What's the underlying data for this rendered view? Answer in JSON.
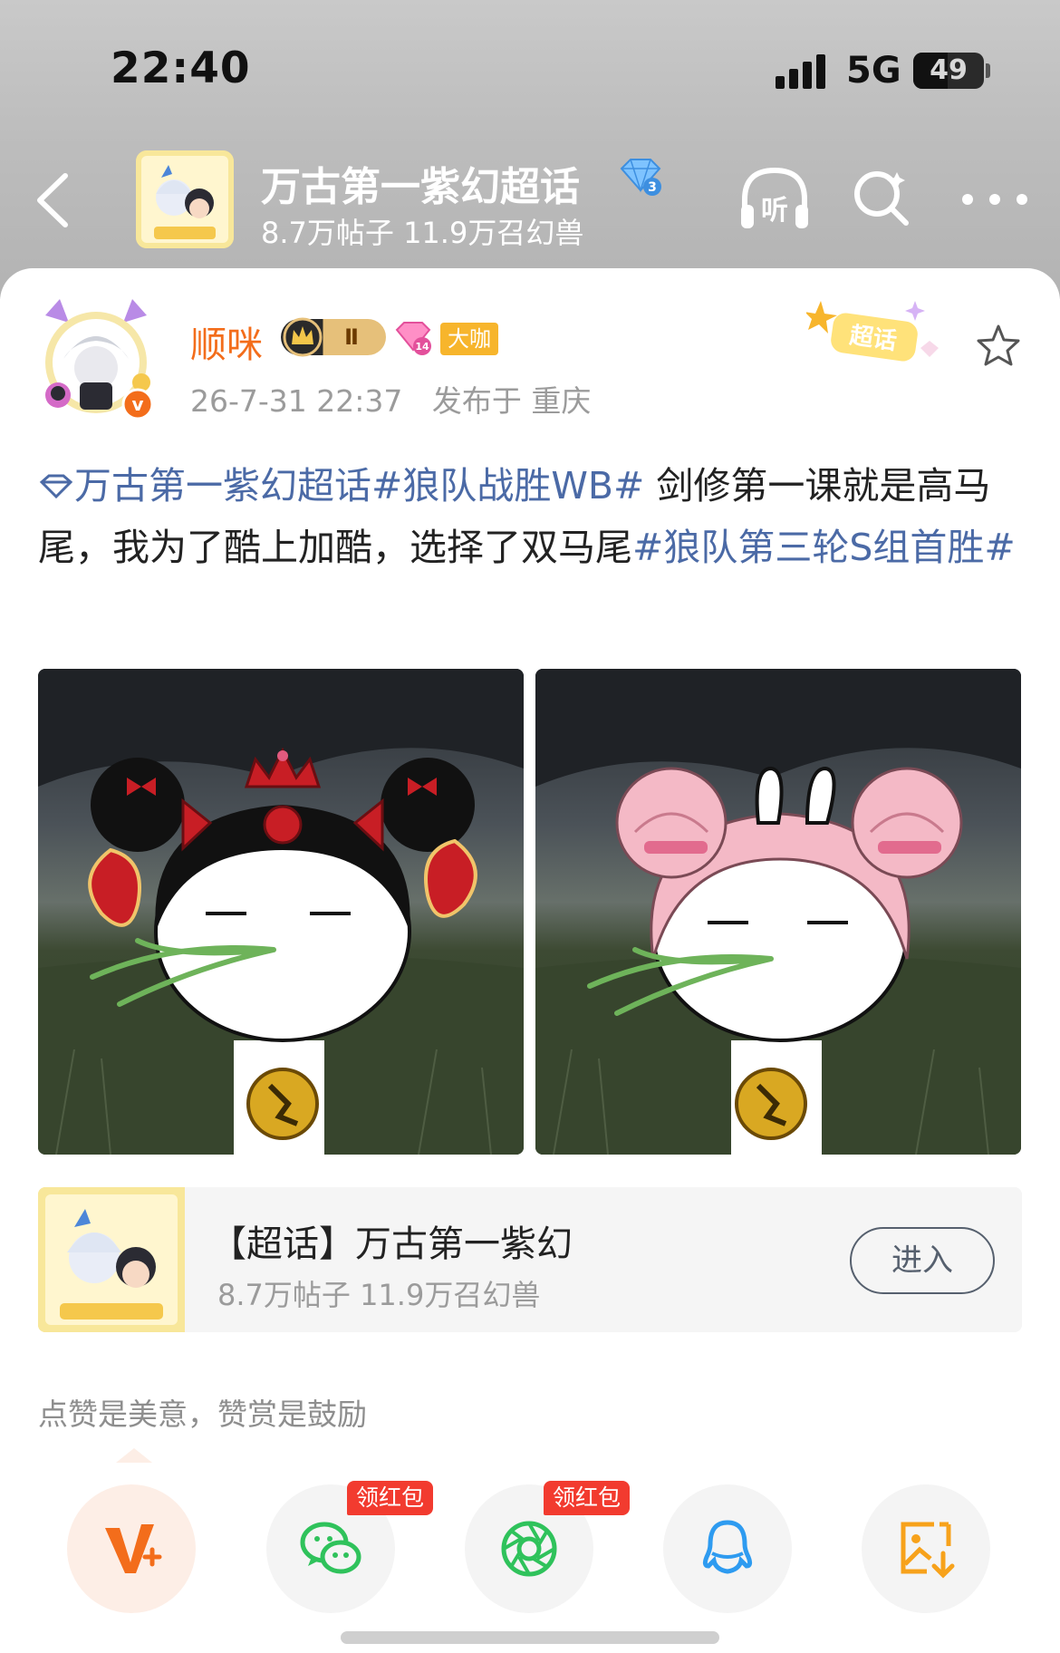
{
  "status_bar": {
    "time": "22:40",
    "network": "5G",
    "battery_level": "49"
  },
  "nav": {
    "title": "万古第一紫幻超话",
    "level_badge": "3",
    "subtitle": "8.7万帖子 11.9万召幻兽",
    "icons": [
      "back-icon",
      "listen-icon",
      "search-icon",
      "more-icon"
    ],
    "listen_label": "听"
  },
  "post": {
    "author": "顺咪",
    "vip_level": "Ⅱ",
    "gem_level": "14",
    "dk_badge": "大咖",
    "time": "26-7-31 22:37",
    "location": "发布于 重庆",
    "sticker_label": "超话",
    "text": {
      "topic_link": "万古第一紫幻超话",
      "hashtag_1": "#狼队战胜WB#",
      "body": " 剑修第一课就是高马尾，我为了酷上加酷，选择了双马尾",
      "hashtag_2": "#狼队第三轮S组首胜#"
    },
    "images": [
      "bunny-character-double-ponytail",
      "bunny-character-pink-buns"
    ]
  },
  "topic_card": {
    "title": "【超话】万古第一紫幻",
    "subtitle": "8.7万帖子 11.9万召幻兽",
    "enter_label": "进入"
  },
  "reward": {
    "tip": "点赞是美意，赞赏是鼓励"
  },
  "share": {
    "items": [
      {
        "name": "v-plus",
        "badge": ""
      },
      {
        "name": "wechat",
        "badge": "领红包"
      },
      {
        "name": "moments",
        "badge": "领红包"
      },
      {
        "name": "qq",
        "badge": ""
      },
      {
        "name": "save-image",
        "badge": ""
      }
    ]
  },
  "colors": {
    "accent_orange": "#f36d1b",
    "link_blue": "#4b6aa6",
    "hongbao_red": "#f23b2f",
    "wechat_green": "#2fc25b",
    "qq_blue": "#2e9bf0"
  }
}
